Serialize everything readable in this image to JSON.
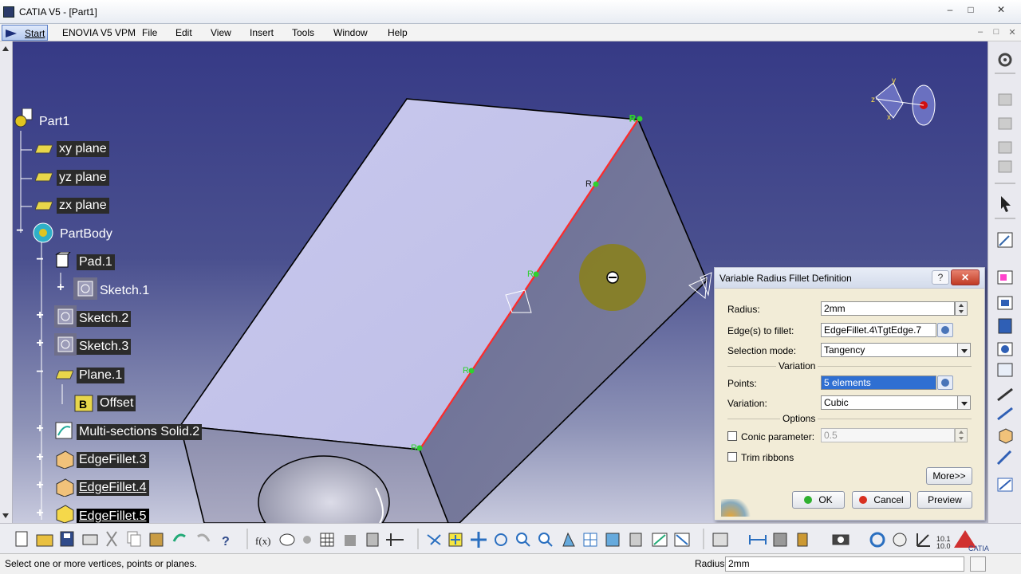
{
  "window": {
    "title": "CATIA V5 - [Part1]",
    "min_symbol": "–",
    "max_symbol": "□",
    "close_symbol": "✕"
  },
  "menubar": {
    "start": "Start",
    "items": [
      "ENOVIA V5 VPM",
      "File",
      "Edit",
      "View",
      "Insert",
      "Tools",
      "Window",
      "Help"
    ]
  },
  "tree": {
    "root": "Part1",
    "xy_plane": "xy plane",
    "yz_plane": "yz plane",
    "zx_plane": "zx plane",
    "partbody": "PartBody",
    "pad": "Pad.1",
    "sketch1": "Sketch.1",
    "sketch2": "Sketch.2",
    "sketch3": "Sketch.3",
    "plane1": "Plane.1",
    "offset": "Offset",
    "multisections": "Multi-sections Solid.2",
    "edgefillet3": "EdgeFillet.3",
    "edgefillet4": "EdgeFillet.4",
    "edgefillet5": "EdgeFillet.5"
  },
  "dialog": {
    "title": "Variable Radius Fillet Definition",
    "help_symbol": "?",
    "close_symbol": "✕",
    "radius_label": "Radius:",
    "radius_value": "2mm",
    "edges_label": "Edge(s) to fillet:",
    "edges_value": "EdgeFillet.4\\TgtEdge.7",
    "selection_mode_label": "Selection mode:",
    "selection_mode_value": "Tangency",
    "variation_group": "Variation",
    "points_label": "Points:",
    "points_value": "5 elements",
    "variation_label": "Variation:",
    "variation_value": "Cubic",
    "options_group": "Options",
    "conic_label": "Conic parameter:",
    "conic_value": "0.5",
    "trim_label": "Trim ribbons",
    "more_button": "More>>",
    "ok_button": "OK",
    "cancel_button": "Cancel",
    "preview_button": "Preview"
  },
  "status": {
    "message": "Select one or more vertices, points or planes.",
    "radius_label": "Radius",
    "radius_value": "2mm"
  },
  "colors": {
    "background_top": "#363a86",
    "highlight_edge": "#ff2a2a",
    "point_marker": "#2fd02f",
    "dialog_bg": "#f2ecd7",
    "selection_blue": "#2f6fd2"
  }
}
